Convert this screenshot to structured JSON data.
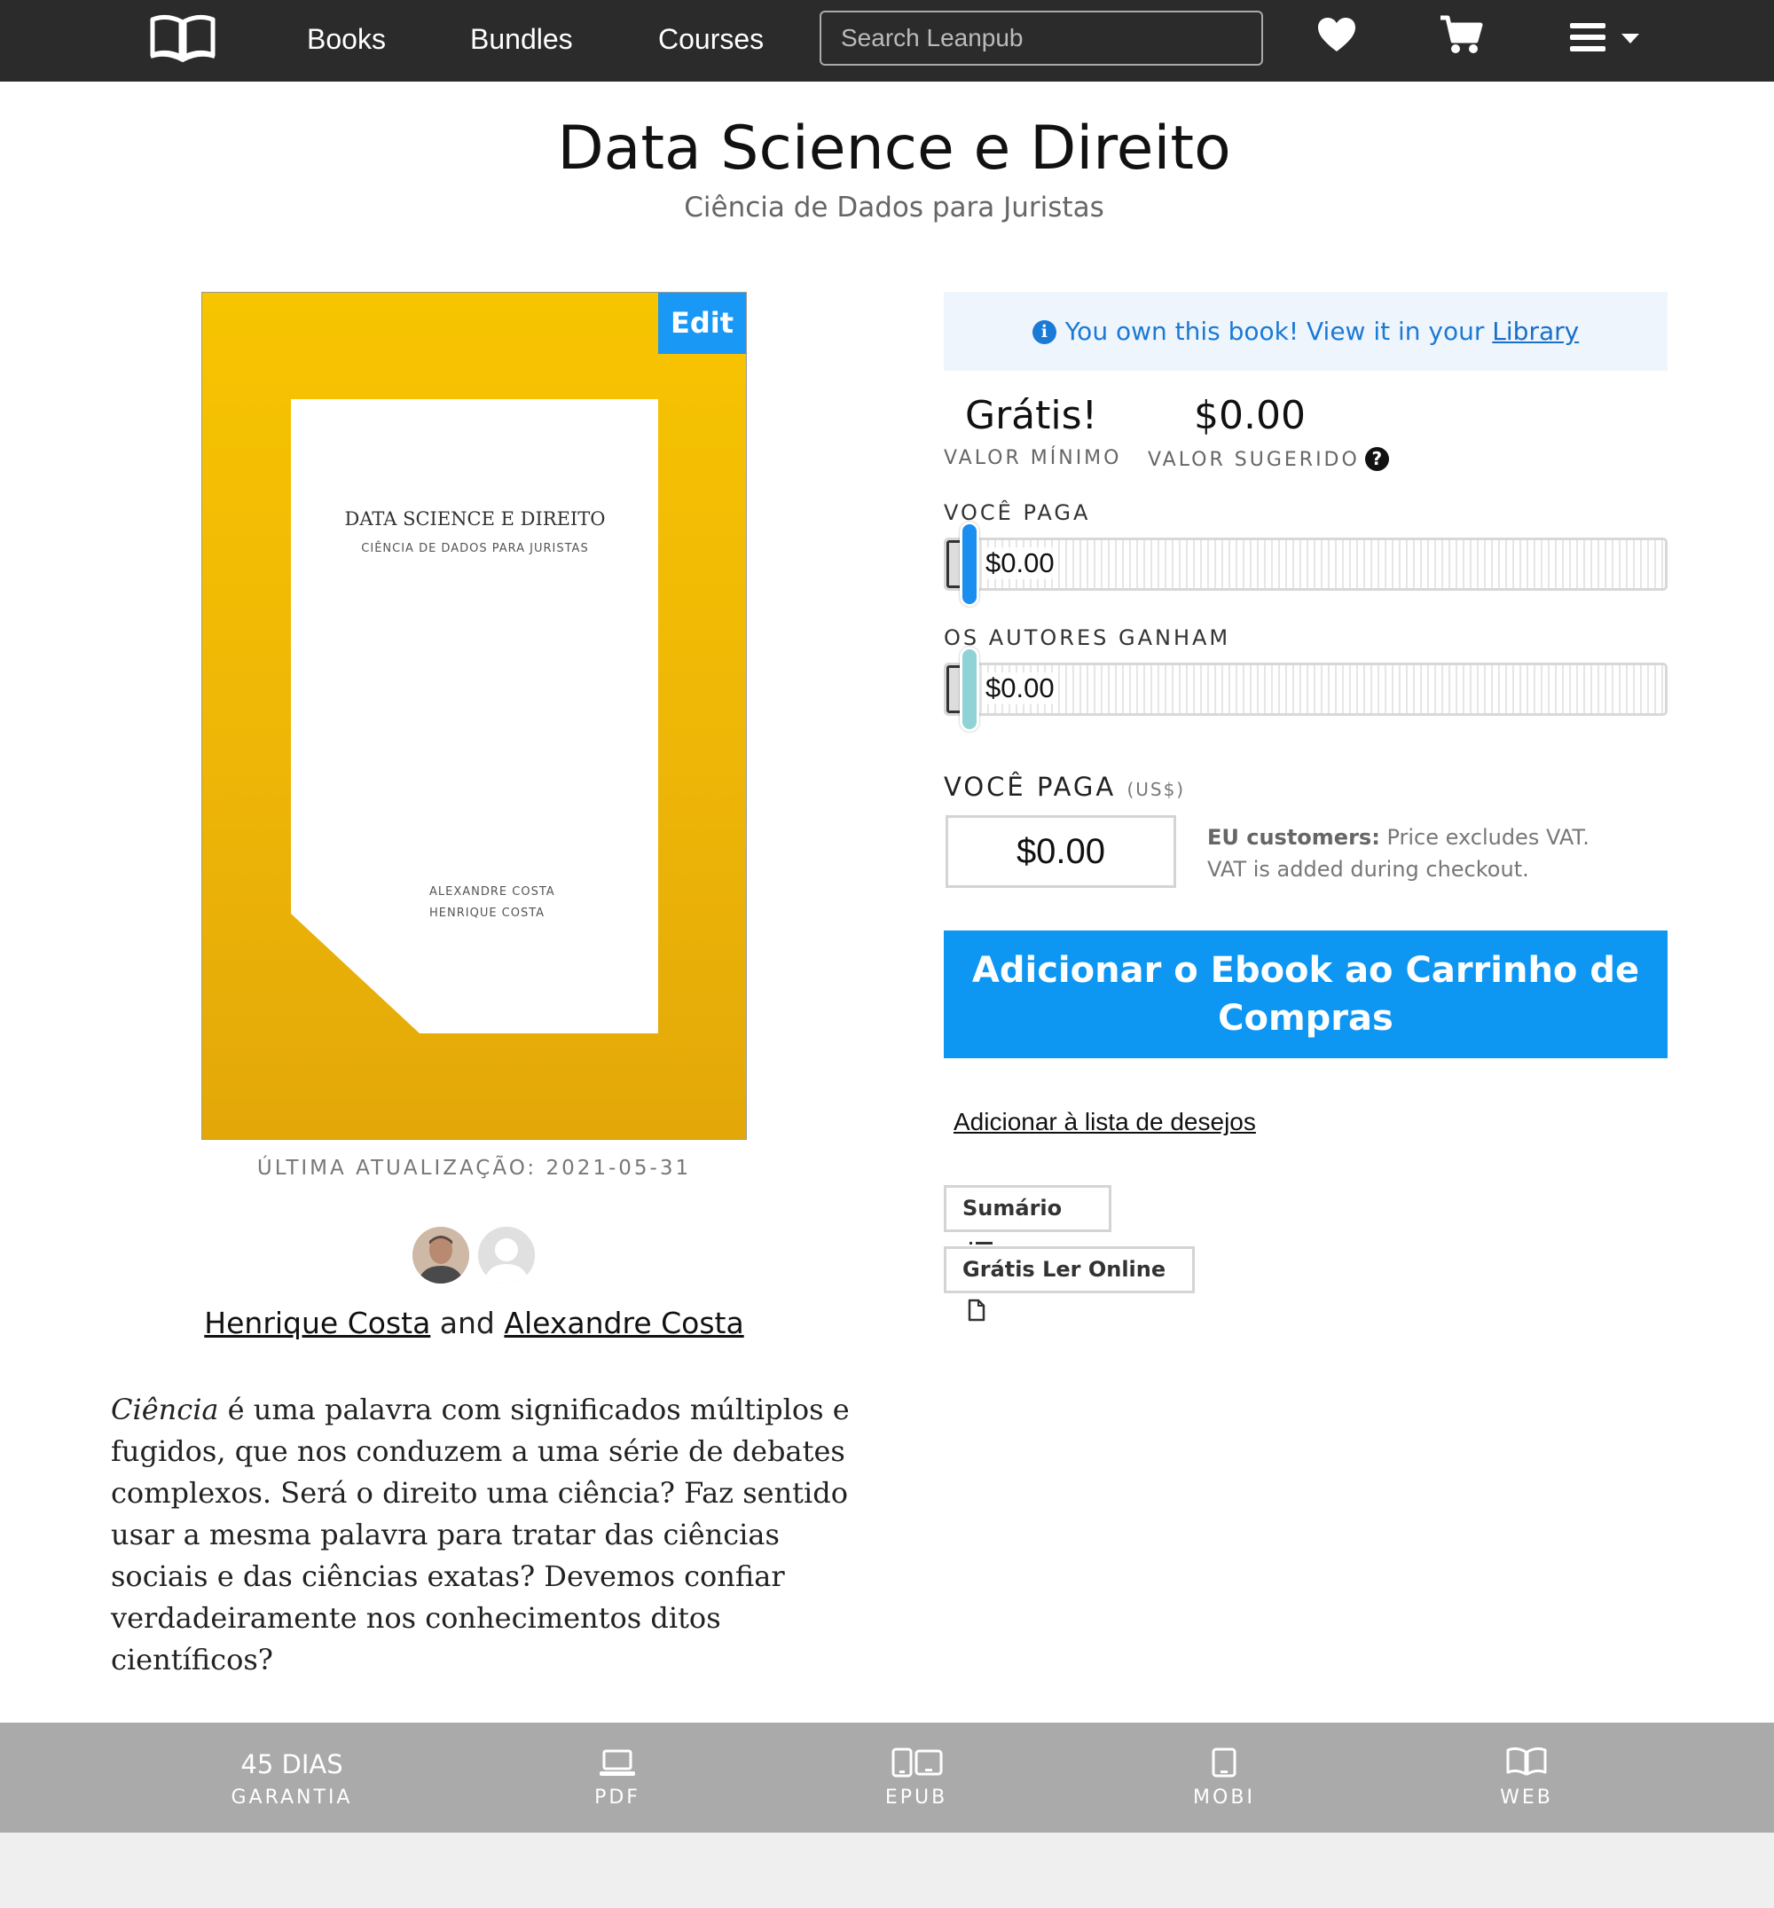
{
  "nav": {
    "links": [
      "Books",
      "Bundles",
      "Courses"
    ],
    "search_placeholder": "Search Leanpub",
    "icons": [
      "book-logo-icon",
      "heart-icon",
      "cart-icon",
      "menu-icon",
      "caret-down-icon"
    ]
  },
  "book": {
    "title": "Data Science e Direito",
    "subtitle": "Ciência de Dados para Juristas",
    "cover": {
      "title": "DATA SCIENCE E DIREITO",
      "subtitle": "CIÊNCIA DE DADOS PARA JURISTAS",
      "authors": [
        "ALEXANDRE COSTA",
        "HENRIQUE COSTA"
      ],
      "edit_label": "Edit",
      "color": "#f5c000"
    },
    "updated": "ÚLTIMA ATUALIZAÇÃO: 2021-05-31",
    "authors": {
      "first": "Henrique Costa",
      "joiner": "and",
      "second": "Alexandre Costa"
    },
    "blurb": {
      "lead": "Ciência",
      "rest": " é uma palavra com significados múltiplos e fugidos, que nos conduzem a uma série de debates complexos. Será o direito uma ciência? Faz sentido usar a mesma palavra para tratar das ciências sociais e das ciências exatas? Devemos confiar verdadeiramente nos conhecimentos ditos científicos?"
    }
  },
  "purchase": {
    "owned_text": "You own this book!  View it in your ",
    "owned_link": "Library",
    "min_price": "Grátis!",
    "min_label": "VALOR MÍNIMO",
    "suggested_price": "$0.00",
    "suggested_label": "VALOR SUGERIDO",
    "pay_slider_label": "VOCÊ PAGA",
    "pay_slider_value": "$0.00",
    "pay_slider_level": 0,
    "authors_slider_label": "OS AUTORES GANHAM",
    "authors_slider_value": "$0.00",
    "authors_slider_level": 0,
    "pay_label": "VOCÊ PAGA",
    "pay_currency": "(US$)",
    "pay_amount": "$0.00",
    "vat_bold": "EU customers:",
    "vat_text": " Price excludes VAT.",
    "vat_text2": "VAT is added during checkout.",
    "cta_line1": "Adicionar o Ebook ao Carrinho de",
    "cta_line2": "Compras",
    "wishlist": "Adicionar à lista de desejos",
    "toc_button": "Sumário",
    "read_online_button": "Grátis Ler Online",
    "colors": {
      "accent": "#0d96f2",
      "pay_handle": "#1a8ff0",
      "authors_handle": "#8fd3d6"
    }
  },
  "footer": {
    "guarantee_big": "45 DIAS",
    "guarantee_label": "GARANTIA",
    "formats": [
      "PDF",
      "EPUB",
      "MOBI",
      "WEB"
    ]
  }
}
